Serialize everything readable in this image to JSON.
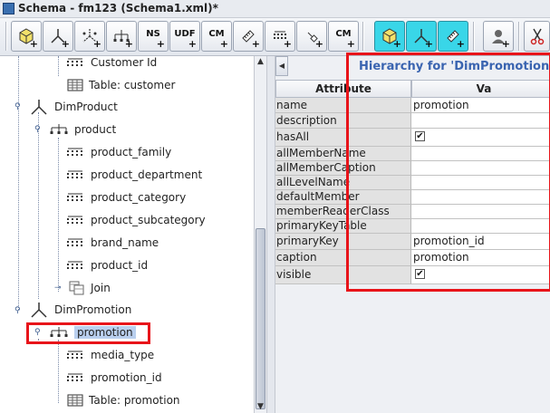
{
  "window": {
    "title": "Schema - fm123 (Schema1.xml)*"
  },
  "toolbar": {
    "buttons": [
      {
        "name": "add-cube-button",
        "label": "",
        "icon": "cube-icon",
        "active": false
      },
      {
        "name": "add-dimension-button",
        "label": "",
        "icon": "dimension-icon",
        "active": false
      },
      {
        "name": "add-dimension-usage-button",
        "label": "",
        "icon": "dimension-usage-icon",
        "active": false
      },
      {
        "name": "add-hierarchy-button",
        "label": "",
        "icon": "hierarchy-icon",
        "active": false
      },
      {
        "name": "add-named-set-button",
        "label": "NS",
        "icon": "",
        "active": false
      },
      {
        "name": "add-udf-button",
        "label": "UDF",
        "icon": "",
        "active": false
      },
      {
        "name": "add-calculated-member-button",
        "label": "CM",
        "icon": "",
        "active": false
      },
      {
        "name": "add-measure-button",
        "label": "",
        "icon": "measure-icon",
        "active": false
      },
      {
        "name": "add-level-button",
        "label": "",
        "icon": "level-icon",
        "active": false
      },
      {
        "name": "add-property-button",
        "label": "",
        "icon": "property-icon",
        "active": false
      },
      {
        "name": "add-cm-property-button",
        "label": "CM",
        "icon": "",
        "active": false
      },
      {
        "name": "add-virtual-cube-button",
        "label": "",
        "icon": "cube-icon",
        "active": true
      },
      {
        "name": "add-virtual-dimension-button",
        "label": "",
        "icon": "dimension-icon",
        "active": true
      },
      {
        "name": "add-virtual-measure-button",
        "label": "",
        "icon": "measure-icon",
        "active": true
      },
      {
        "name": "add-role-button",
        "label": "",
        "icon": "user-icon",
        "active": false
      },
      {
        "name": "cut-button",
        "label": "",
        "icon": "scissors-icon",
        "active": false
      }
    ]
  },
  "tree": {
    "items": [
      {
        "label": "Customer Id",
        "icon": "level-icon"
      },
      {
        "label": "Table: customer",
        "icon": "table-icon"
      },
      {
        "label": "DimProduct",
        "icon": "dimension-icon"
      },
      {
        "label": "product",
        "icon": "hierarchy-icon"
      },
      {
        "label": "product_family",
        "icon": "level-icon"
      },
      {
        "label": "product_department",
        "icon": "level-icon"
      },
      {
        "label": "product_category",
        "icon": "level-icon"
      },
      {
        "label": "product_subcategory",
        "icon": "level-icon"
      },
      {
        "label": "brand_name",
        "icon": "level-icon"
      },
      {
        "label": "product_id",
        "icon": "level-icon"
      },
      {
        "label": "Join",
        "icon": "join-icon"
      },
      {
        "label": "DimPromotion",
        "icon": "dimension-icon"
      },
      {
        "label": "promotion",
        "icon": "hierarchy-icon"
      },
      {
        "label": "media_type",
        "icon": "level-icon"
      },
      {
        "label": "promotion_id",
        "icon": "level-icon"
      },
      {
        "label": "Table: promotion",
        "icon": "table-icon"
      }
    ]
  },
  "properties": {
    "title": "Hierarchy for 'DimPromotion' D",
    "headers": {
      "attribute": "Attribute",
      "value": "Va"
    },
    "rows": [
      {
        "key": "name",
        "value": "promotion",
        "checkbox": false
      },
      {
        "key": "description",
        "value": "",
        "checkbox": false
      },
      {
        "key": "hasAll",
        "value": "",
        "checkbox": true,
        "checked": true
      },
      {
        "key": "allMemberName",
        "value": "",
        "checkbox": false
      },
      {
        "key": "allMemberCaption",
        "value": "",
        "checkbox": false
      },
      {
        "key": "allLevelName",
        "value": "",
        "checkbox": false
      },
      {
        "key": "defaultMember",
        "value": "",
        "checkbox": false
      },
      {
        "key": "memberReaderClass",
        "value": "",
        "checkbox": false
      },
      {
        "key": "primaryKeyTable",
        "value": "",
        "checkbox": false
      },
      {
        "key": "primaryKey",
        "value": "promotion_id",
        "checkbox": false
      },
      {
        "key": "caption",
        "value": "promotion",
        "checkbox": false
      },
      {
        "key": "visible",
        "value": "",
        "checkbox": true,
        "checked": true
      }
    ]
  },
  "colors": {
    "highlight": "#e8141a",
    "title_blue": "#3a64b0",
    "active_button": "#39d6e8",
    "selection": "#b9cfee"
  }
}
